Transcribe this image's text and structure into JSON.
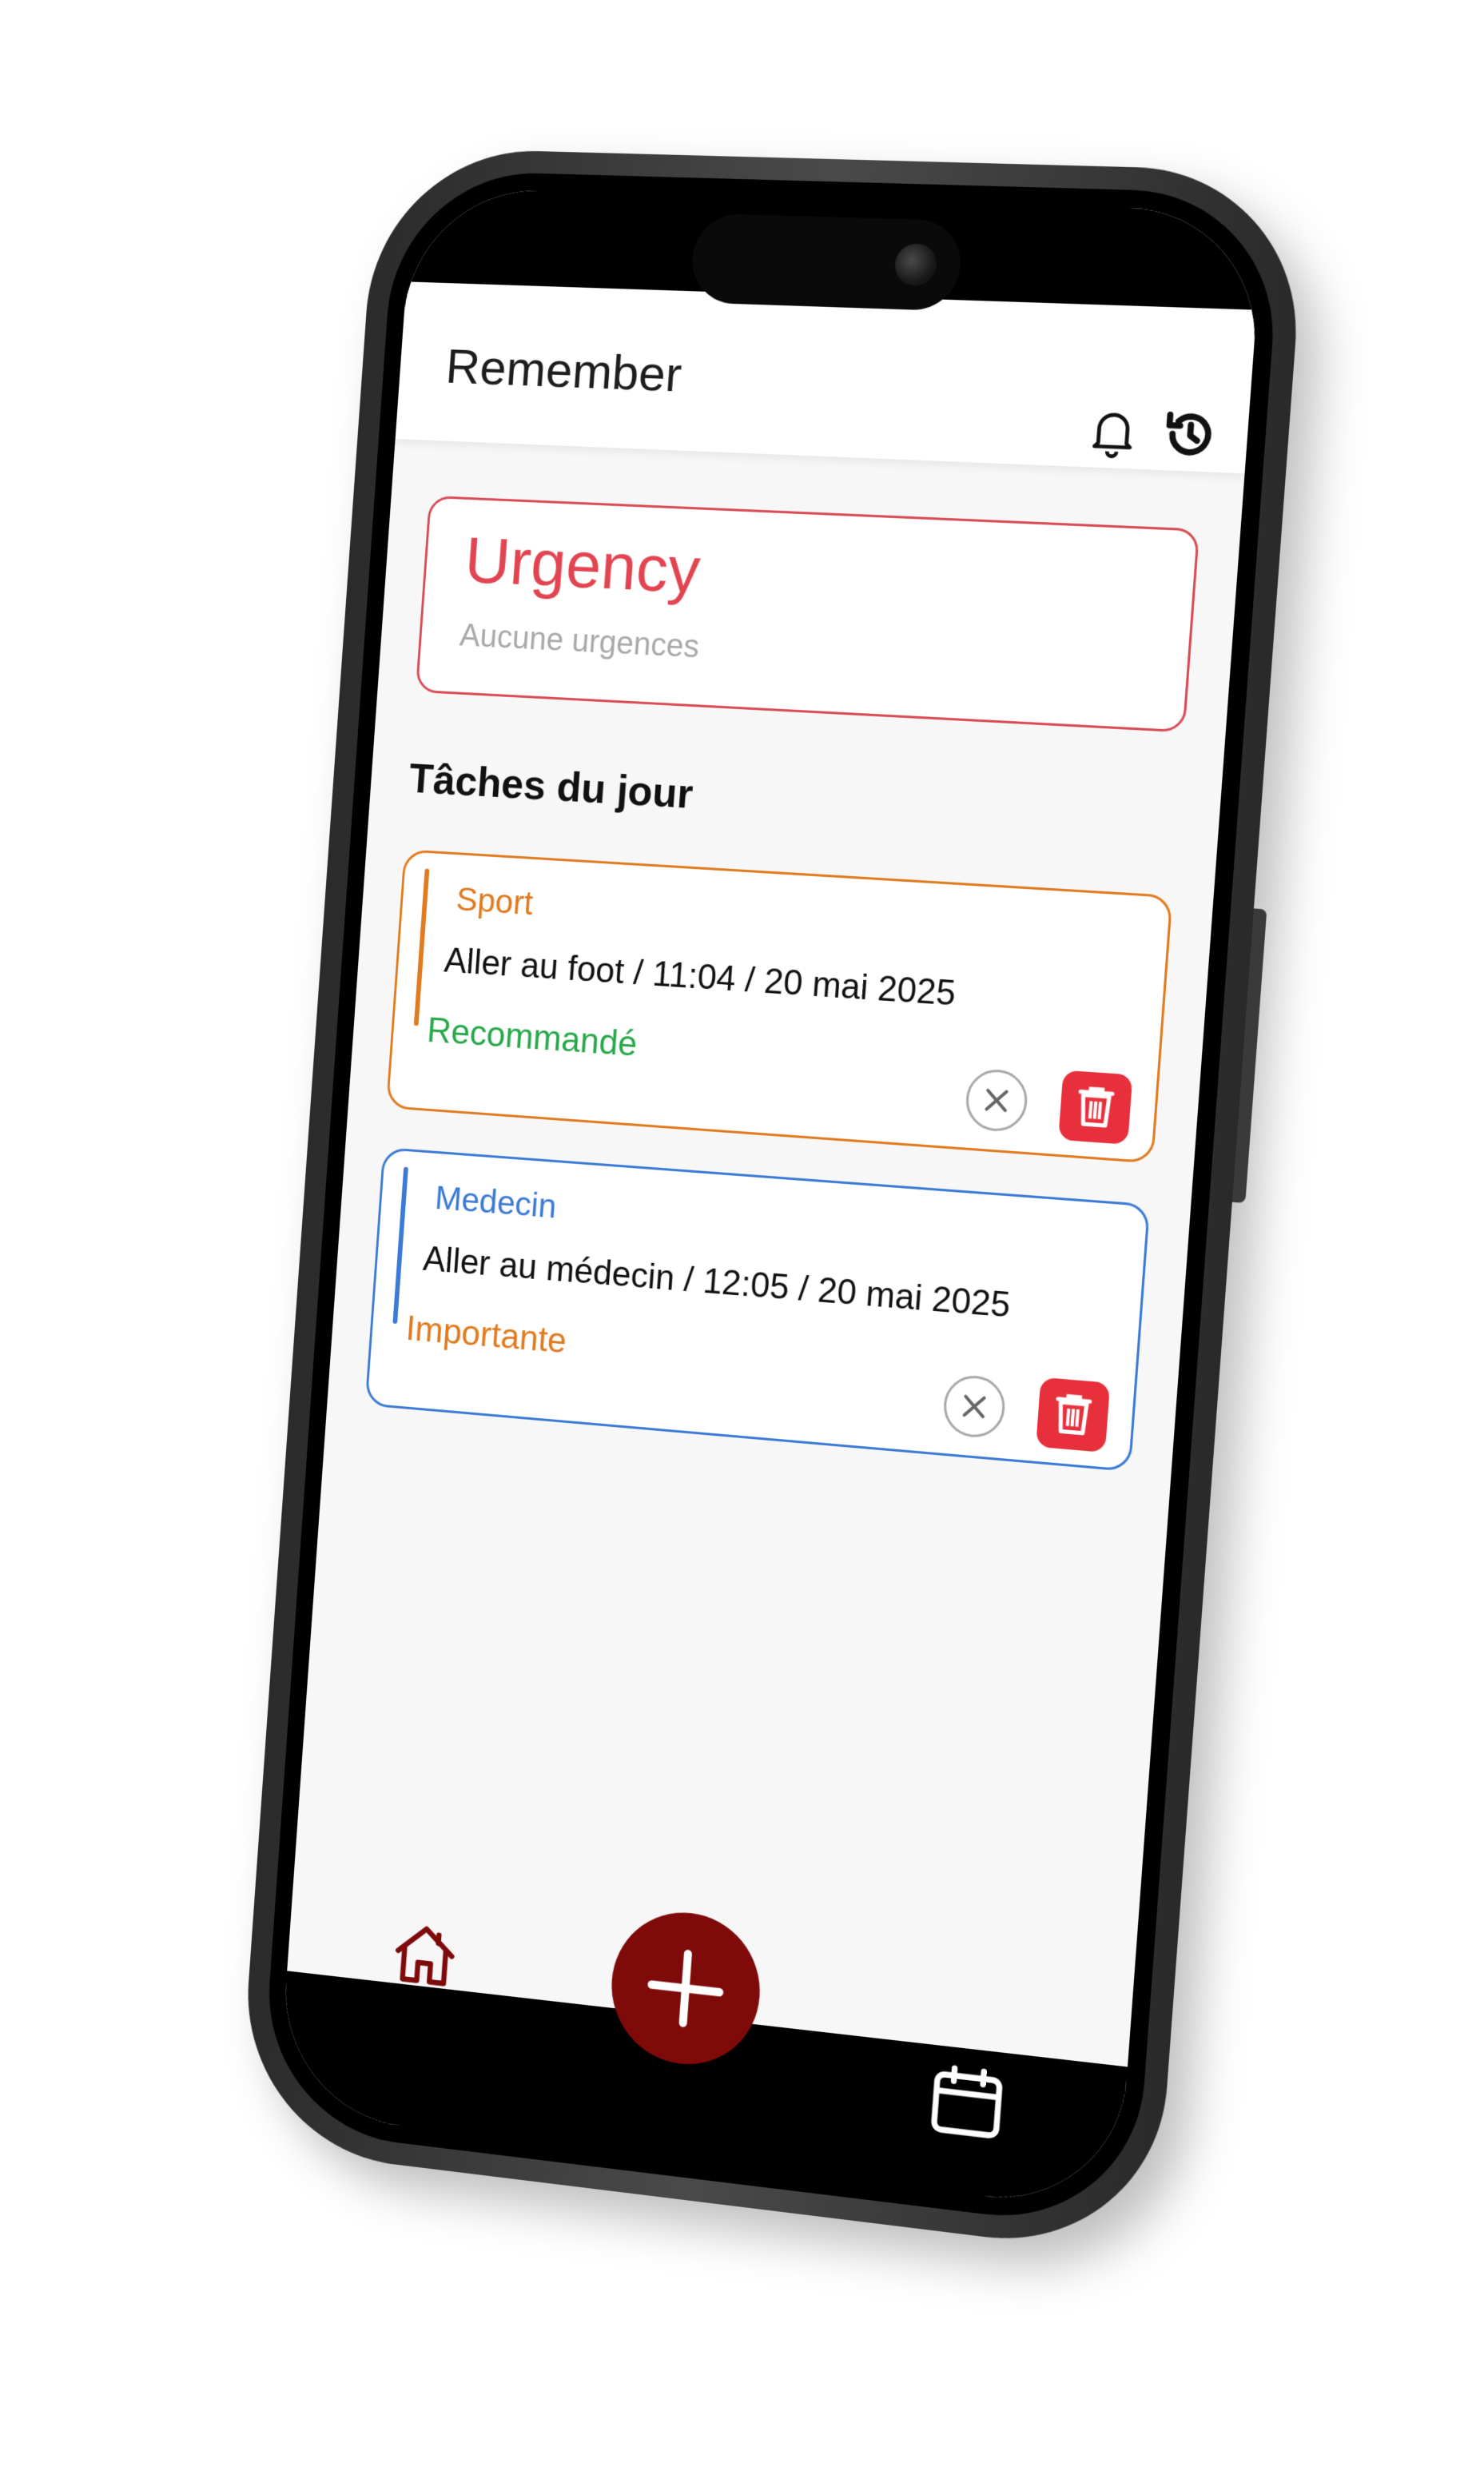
{
  "app": {
    "title": "Remember"
  },
  "header": {
    "icons": [
      "bell-icon",
      "history-icon"
    ]
  },
  "urgency": {
    "title": "Urgency",
    "empty_text": "Aucune urgences",
    "color": "#e24552"
  },
  "tasks_section": {
    "title": "Tâches du jour",
    "tasks": [
      {
        "category": "Sport",
        "description": "Aller au foot / 11:04 /  20 mai 2025",
        "priority": "Recommandé",
        "category_color": "#e07b20",
        "priority_color": "#27a84a"
      },
      {
        "category": "Medecin",
        "description": "Aller au médecin  / 12:05 /  20 mai 2025",
        "priority": "Importante",
        "category_color": "#3b7bd6",
        "priority_color": "#e07b20"
      }
    ]
  },
  "bottom_nav": {
    "icons": [
      "home-icon",
      "plus-icon",
      "calendar-icon"
    ],
    "fab_color": "#7e0a0a"
  }
}
